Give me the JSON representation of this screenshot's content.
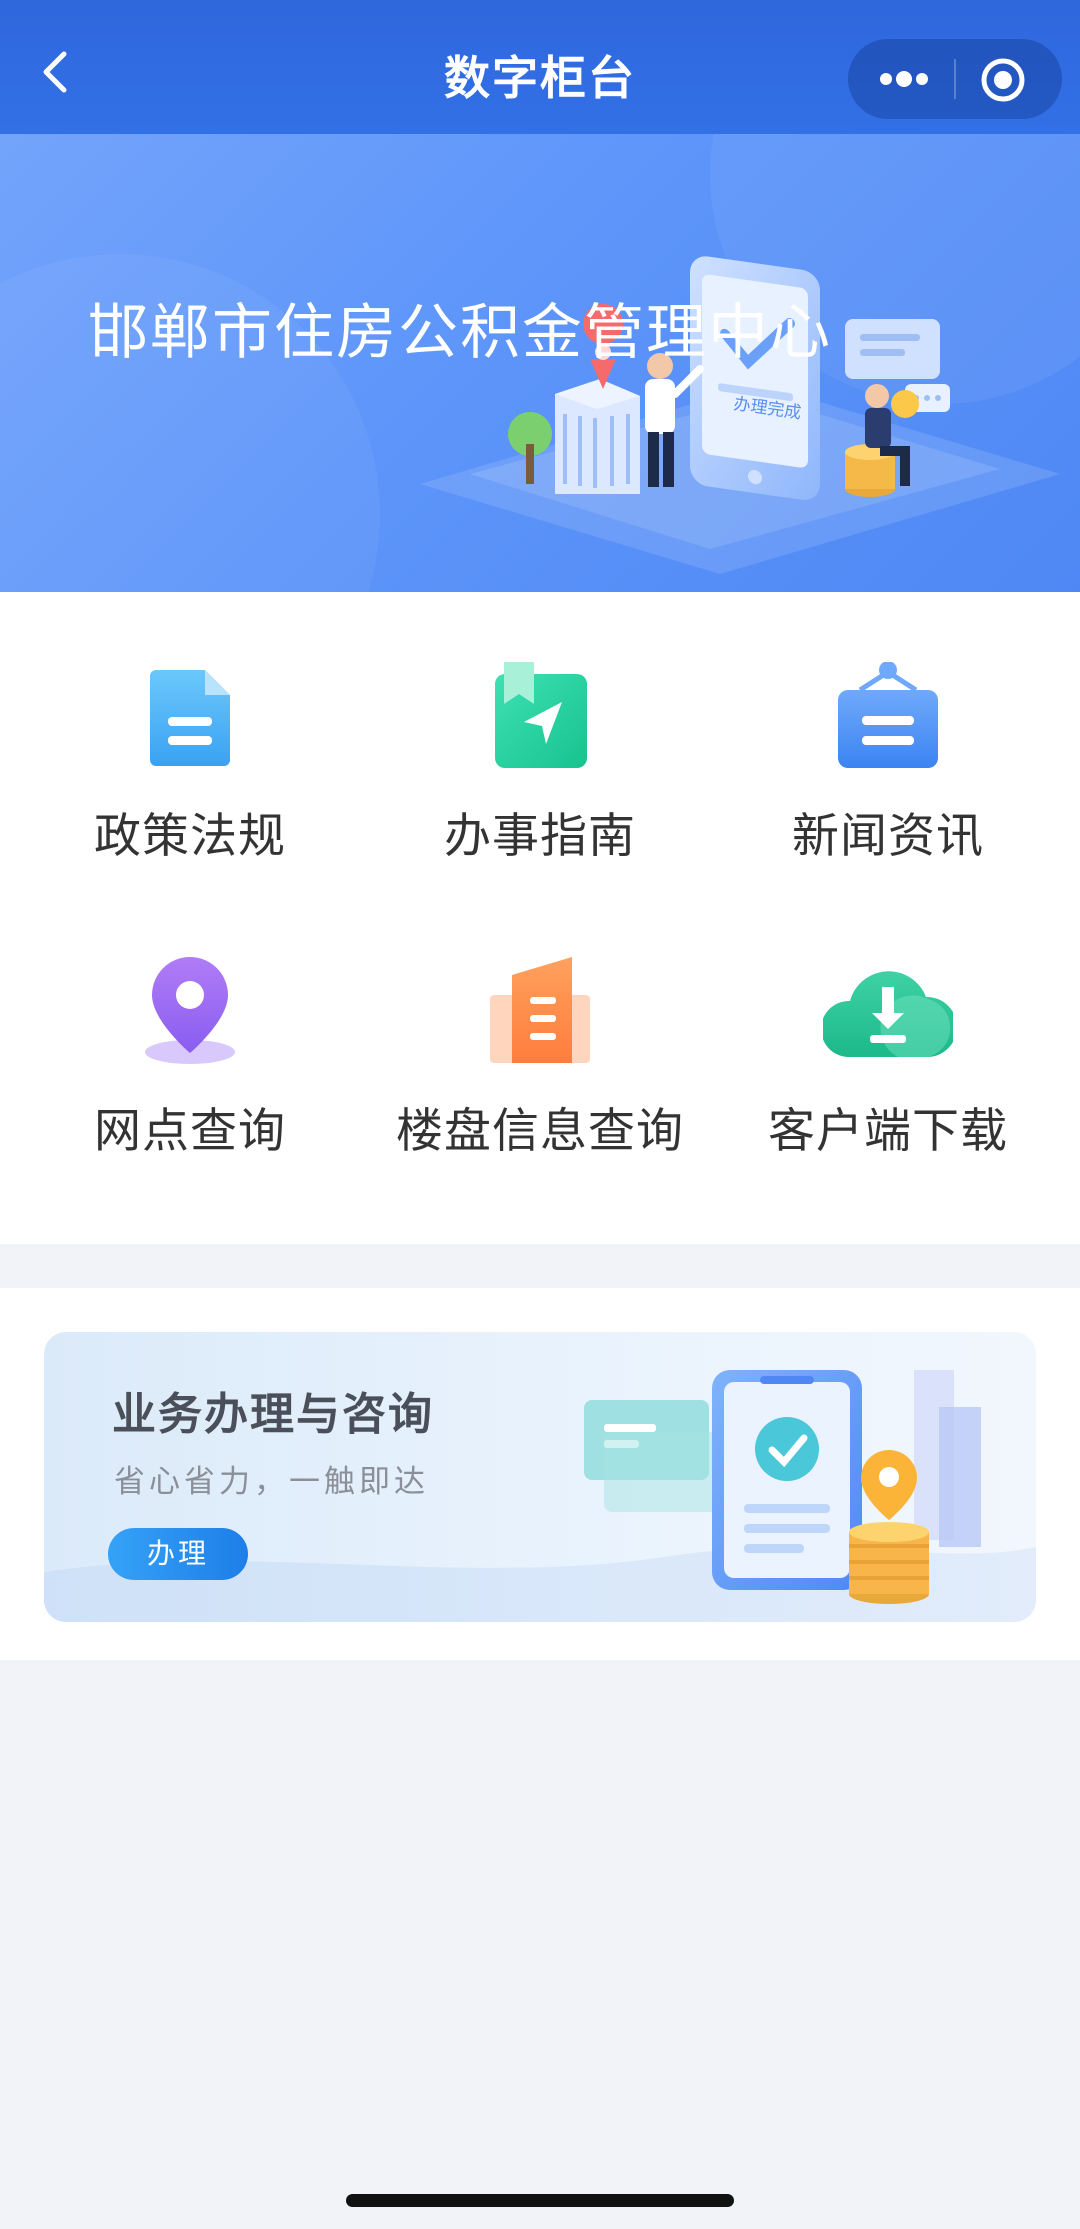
{
  "navbar": {
    "title": "数字柜台",
    "back_icon": "chevron-left-icon",
    "more_icon": "more-dots-icon",
    "close_icon": "target-circle-icon",
    "color": "#3270e6"
  },
  "banner": {
    "title": "邯郸市住房公积金管理中心",
    "art_label": "办理完成"
  },
  "menu": {
    "items": [
      {
        "label": "政策法规",
        "icon": "document-icon"
      },
      {
        "label": "办事指南",
        "icon": "guide-navigation-icon"
      },
      {
        "label": "新闻资讯",
        "icon": "news-board-icon"
      },
      {
        "label": "网点查询",
        "icon": "location-pin-icon"
      },
      {
        "label": "楼盘信息查询",
        "icon": "building-icon"
      },
      {
        "label": "客户端下载",
        "icon": "cloud-download-icon"
      }
    ]
  },
  "card": {
    "title": "业务办理与咨询",
    "subtitle": "省心省力，一触即达",
    "button_label": "办理"
  }
}
